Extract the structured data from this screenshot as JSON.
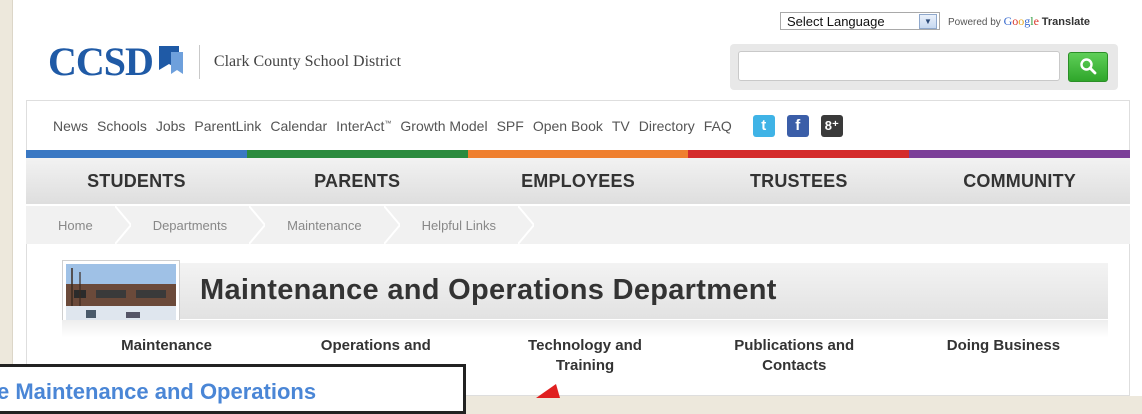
{
  "translate": {
    "select_label": "Select Language",
    "powered_by": "Powered by",
    "google_letters": [
      "G",
      "o",
      "o",
      "g",
      "l",
      "e"
    ],
    "translate_word": "Translate"
  },
  "header": {
    "logo_text": "CCSD",
    "district_name": "Clark County School District",
    "search_placeholder": ""
  },
  "utility_nav": [
    {
      "label": "News"
    },
    {
      "label": "Schools"
    },
    {
      "label": "Jobs"
    },
    {
      "label": "ParentLink"
    },
    {
      "label": "Calendar"
    },
    {
      "label": "InterAct"
    },
    {
      "label": "Growth Model"
    },
    {
      "label": "SPF"
    },
    {
      "label": "Open Book"
    },
    {
      "label": "TV"
    },
    {
      "label": "Directory"
    },
    {
      "label": "FAQ"
    }
  ],
  "interact_mark": "™",
  "social": {
    "twitter": "t",
    "facebook": "f",
    "googleplus": "8⁺"
  },
  "color_bar": [
    "#3a78c3",
    "#2b8a3e",
    "#ef7f2e",
    "#d42b2b",
    "#7b3f98"
  ],
  "main_nav": [
    "STUDENTS",
    "PARENTS",
    "EMPLOYEES",
    "TRUSTEES",
    "COMMUNITY"
  ],
  "breadcrumb": [
    "Home",
    "Departments",
    "Maintenance",
    "Helpful Links"
  ],
  "department": {
    "title": "Maintenance and Operations Department",
    "tabs": [
      {
        "label": "Maintenance"
      },
      {
        "label": "Operations and"
      },
      {
        "label": "Technology and\nTraining"
      },
      {
        "label": "Publications and\nContacts"
      },
      {
        "label": "Doing Business"
      }
    ]
  },
  "callout": {
    "text": "e Maintenance and Operations"
  },
  "colors": {
    "brand_blue": "#1f5aa6",
    "search_green": "#3db637",
    "callout_text": "#4a86d6",
    "arrow_red": "#e02020"
  }
}
